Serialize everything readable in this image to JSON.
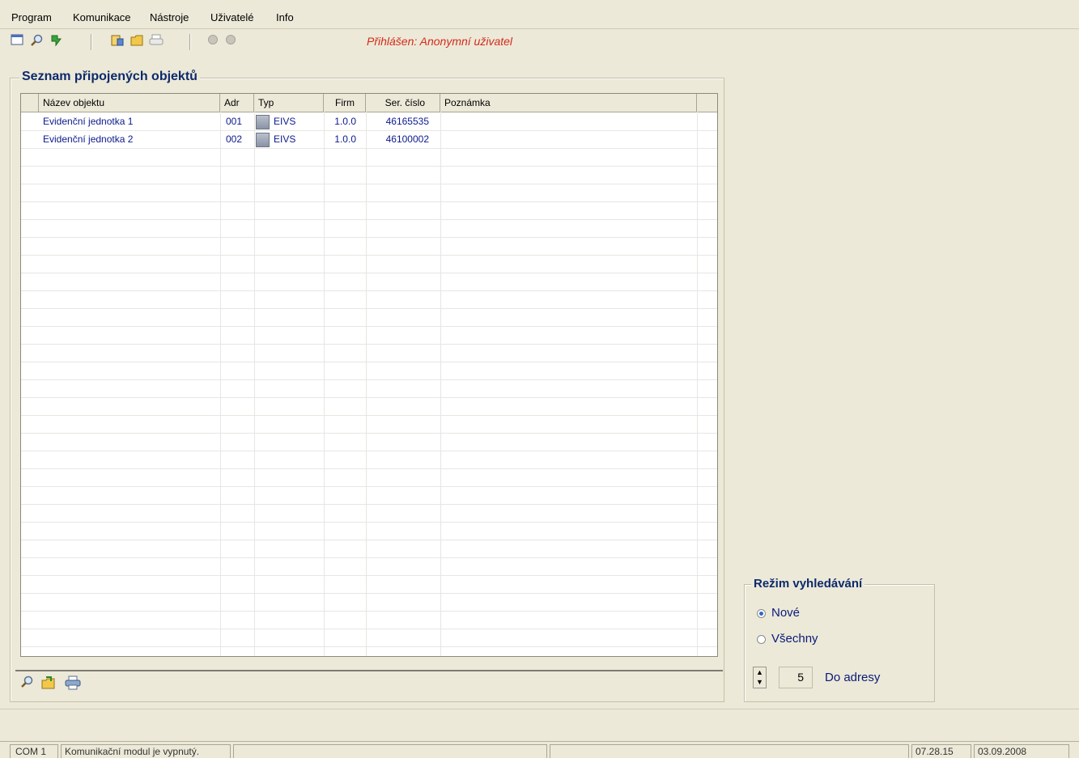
{
  "menu": {
    "program": "Program",
    "komunikace": "Komunikace",
    "nastroje": "Nástroje",
    "uzivatele": "Uživatelé",
    "info": "Info"
  },
  "toolbar": {
    "login_status": "Přihlášen: Anonymní uživatel"
  },
  "objects_panel": {
    "title": "Seznam připojených objektů",
    "columns": [
      "Název objektu",
      "Adr",
      "Typ",
      "Firm",
      "Ser. číslo",
      "Poznámka"
    ],
    "rows": [
      {
        "name": "Evidenční jednotka 1",
        "adr": "001",
        "type": "EIVS",
        "firm": "1.0.0",
        "serial": "46165535",
        "note": ""
      },
      {
        "name": "Evidenční jednotka 2",
        "adr": "002",
        "type": "EIVS",
        "firm": "1.0.0",
        "serial": "46100002",
        "note": ""
      }
    ]
  },
  "search_mode": {
    "title": "Režim vyhledávání",
    "option_new": "Nové",
    "option_all": "Všechny",
    "selected": "Nové",
    "address_value": "5",
    "address_label": "Do adresy"
  },
  "statusbar": {
    "port": "COM 1",
    "message": "Komunikační modul je vypnutý.",
    "time": "07.28.15",
    "date": "03.09.2008"
  },
  "icons": {
    "toolbar": [
      "window-icon",
      "search-icon",
      "connect-icon",
      "data-icon",
      "folder-icon",
      "print-icon",
      "record-icon",
      "stop-icon"
    ],
    "bottom": [
      "search-icon",
      "export-icon",
      "print-icon"
    ]
  }
}
